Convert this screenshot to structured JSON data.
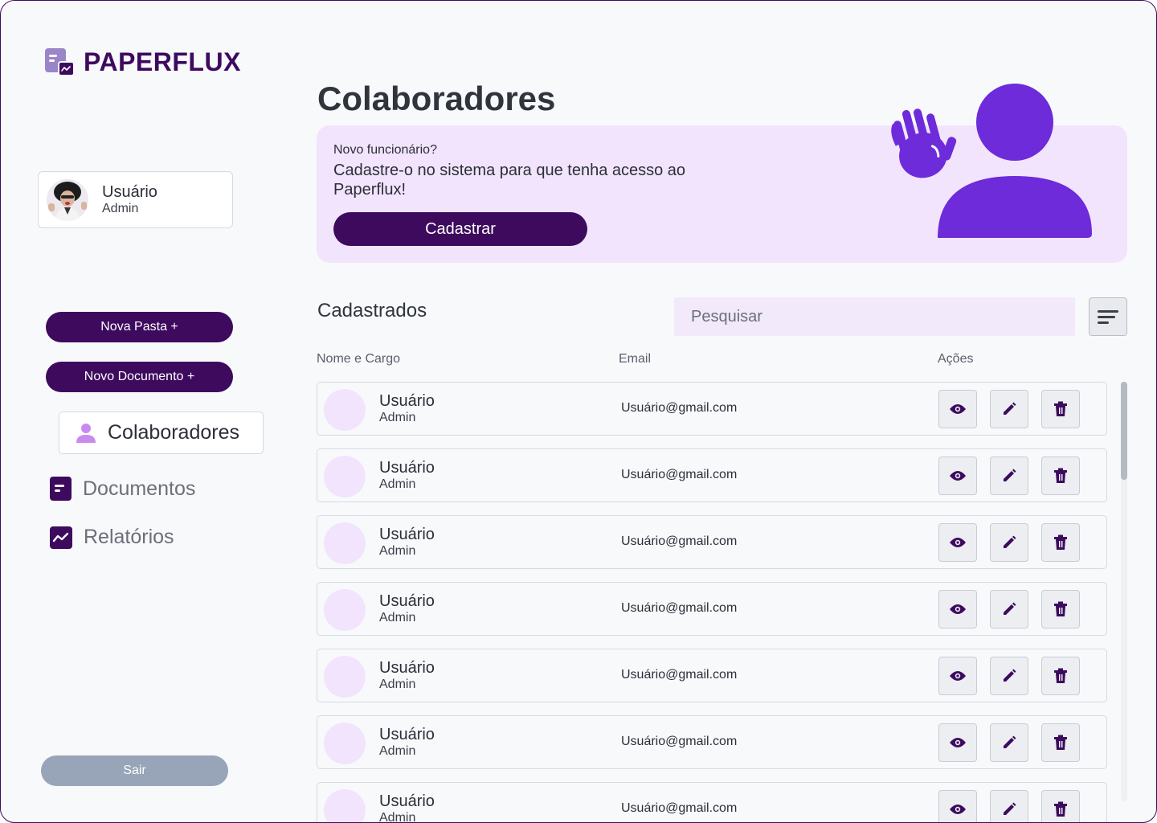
{
  "brand": {
    "name": "PAPERFLUX",
    "color": "#3d0a5e",
    "accent": "#6d2bd9",
    "light_accent": "#f2e4fc"
  },
  "user": {
    "name": "Usuário",
    "role": "Admin"
  },
  "sidebar": {
    "new_folder": "Nova Pasta +",
    "new_document": "Novo Documento +",
    "nav": [
      {
        "label": "Colaboradores",
        "icon": "person-icon",
        "active": true
      },
      {
        "label": "Documentos",
        "icon": "document-icon",
        "active": false
      },
      {
        "label": "Relatórios",
        "icon": "chart-icon",
        "active": false
      }
    ],
    "logout": "Sair"
  },
  "main": {
    "title": "Colaboradores",
    "banner": {
      "question": "Novo funcionário?",
      "text": "Cadastre-o no sistema para que tenha acesso ao Paperflux!",
      "button": "Cadastrar"
    },
    "list_title": "Cadastrados",
    "search_placeholder": "Pesquisar",
    "columns": {
      "name": "Nome e Cargo",
      "email": "Email",
      "actions": "Ações"
    },
    "rows": [
      {
        "name": "Usuário",
        "role": "Admin",
        "email": "Usuário@gmail.com"
      },
      {
        "name": "Usuário",
        "role": "Admin",
        "email": "Usuário@gmail.com"
      },
      {
        "name": "Usuário",
        "role": "Admin",
        "email": "Usuário@gmail.com"
      },
      {
        "name": "Usuário",
        "role": "Admin",
        "email": "Usuário@gmail.com"
      },
      {
        "name": "Usuário",
        "role": "Admin",
        "email": "Usuário@gmail.com"
      },
      {
        "name": "Usuário",
        "role": "Admin",
        "email": "Usuário@gmail.com"
      },
      {
        "name": "Usuário",
        "role": "Admin",
        "email": "Usuário@gmail.com"
      }
    ],
    "row_actions": [
      "eye-icon",
      "pencil-icon",
      "trash-icon"
    ]
  }
}
